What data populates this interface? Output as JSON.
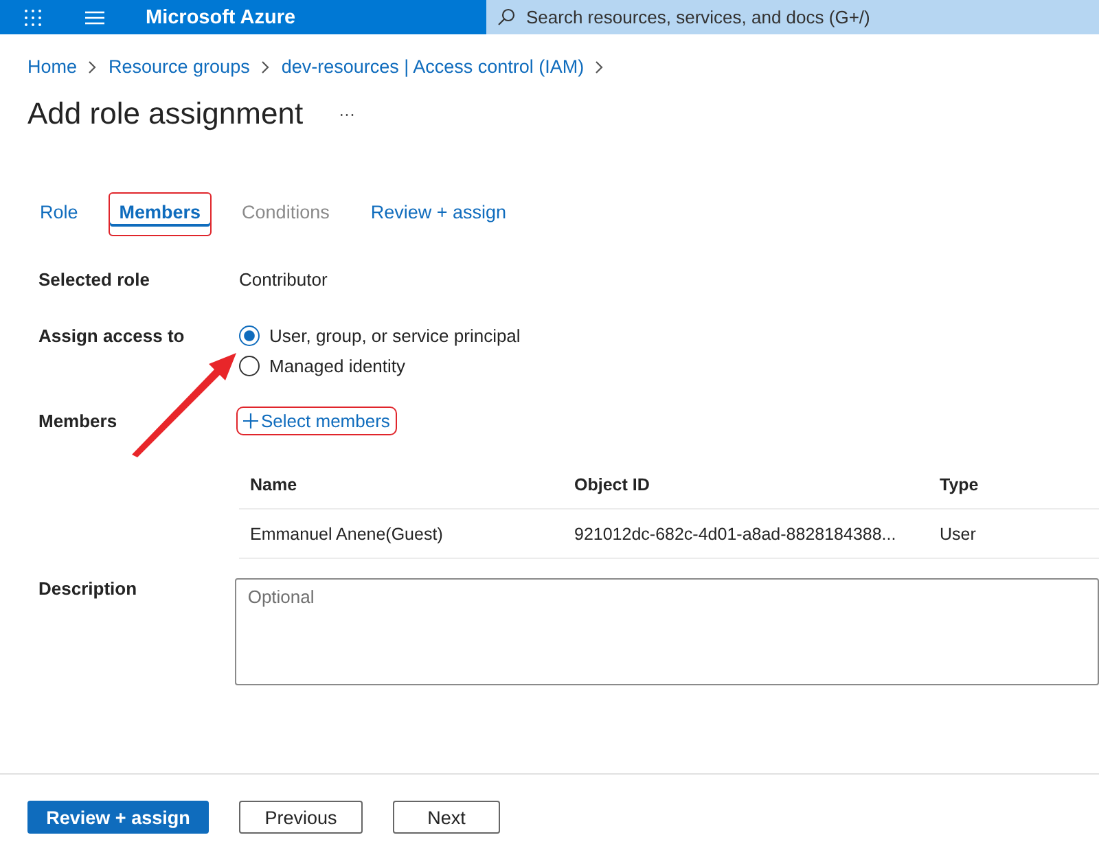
{
  "topbar": {
    "brand": "Microsoft Azure",
    "search": {
      "placeholder": "Search resources, services, and docs (G+/)"
    }
  },
  "breadcrumb": [
    "Home",
    "Resource groups",
    "dev-resources | Access control (IAM)"
  ],
  "title": "Add role assignment",
  "more": "···",
  "tabs": [
    {
      "label": "Role",
      "selected": false,
      "disabled": false,
      "highlighted": false
    },
    {
      "label": "Members",
      "selected": true,
      "disabled": false,
      "highlighted": true
    },
    {
      "label": "Conditions",
      "selected": false,
      "disabled": true,
      "highlighted": false
    },
    {
      "label": "Review + assign",
      "selected": false,
      "disabled": false,
      "highlighted": false
    }
  ],
  "selected_role": {
    "label": "Selected role",
    "value": "Contributor"
  },
  "assign_access": {
    "label": "Assign access to",
    "options": [
      {
        "label": "User, group, or service principal",
        "selected": true
      },
      {
        "label": "Managed identity",
        "selected": false
      }
    ]
  },
  "members": {
    "label": "Members",
    "add_link": {
      "label": "Select members",
      "highlighted": true
    }
  },
  "table": {
    "columns": [
      "Name",
      "Object ID",
      "Type"
    ],
    "rows": [
      [
        "Emmanuel Anene(Guest)",
        "921012dc-682c-4d01-a8ad-8828184388...",
        "User"
      ]
    ]
  },
  "description": {
    "label": "Description",
    "placeholder": "Optional"
  },
  "buttons": [
    {
      "label": "Review + assign",
      "kind": "primary"
    },
    {
      "label": "Previous",
      "kind": "secondary"
    },
    {
      "label": "Next",
      "kind": "secondary"
    }
  ]
}
